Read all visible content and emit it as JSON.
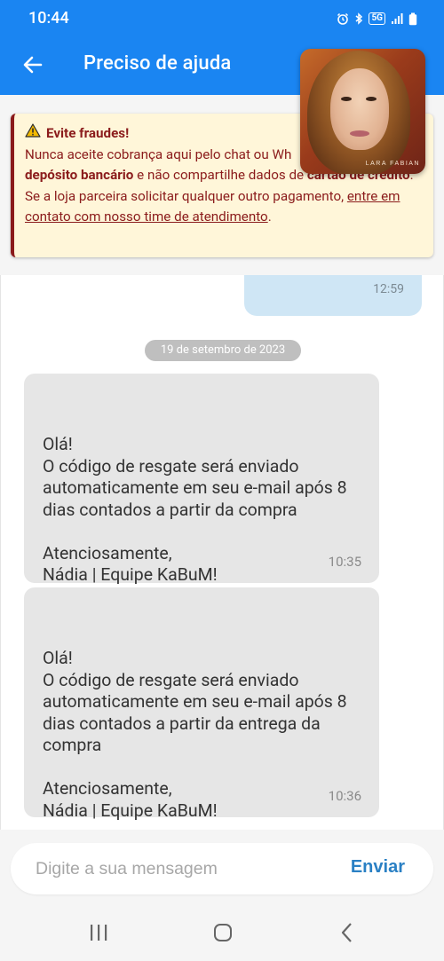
{
  "status_bar": {
    "time": "10:44",
    "network": "5G",
    "icons": [
      "alarm-icon",
      "bluetooth-icon",
      "5g-icon",
      "signal-icon",
      "battery-icon"
    ]
  },
  "app_bar": {
    "title": "Preciso de ajuda",
    "back_icon": "arrow-left-icon",
    "color": "#1a85f2"
  },
  "warning": {
    "title": "Evite fraudes!",
    "line1_a": "Nunca aceite cobrança aqui pelo chat ou Wh",
    "line1_b": "",
    "bold1": "depósito bancário",
    "mid": " e não compartilhe dados de ",
    "bold2": "cartão de crédito",
    "end1": ".",
    "line2_a": "Se a loja parceira solicitar qualquer outro pagamento, ",
    "link": "entre em contato com nosso time de atendimento",
    "end2": ".",
    "colors": {
      "text": "#8b1c1c",
      "background": "#fff6d9"
    }
  },
  "album_art": {
    "artist_text": "LARA FABIAN"
  },
  "chat": {
    "outgoing_time": "12:59",
    "date_chip": "19 de setembro de 2023",
    "messages": [
      {
        "text": "Olá!\nO código de resgate será enviado automaticamente em seu e-mail após 8 dias contados a partir da compra\n\nAtenciosamente,\nNádia | Equipe KaBuM!",
        "time": "10:35"
      },
      {
        "text": "Olá!\nO código de resgate será enviado automaticamente em seu e-mail após 8 dias contados a partir da entrega da compra\n\nAtenciosamente,\nNádia | Equipe KaBuM!",
        "time": "10:36"
      }
    ]
  },
  "composer": {
    "placeholder": "Digite a sua mensagem",
    "send_label": "Enviar",
    "send_color": "#2a80c4"
  },
  "nav_bar": {
    "icons": [
      "recents-icon",
      "home-icon",
      "back-nav-icon"
    ]
  }
}
